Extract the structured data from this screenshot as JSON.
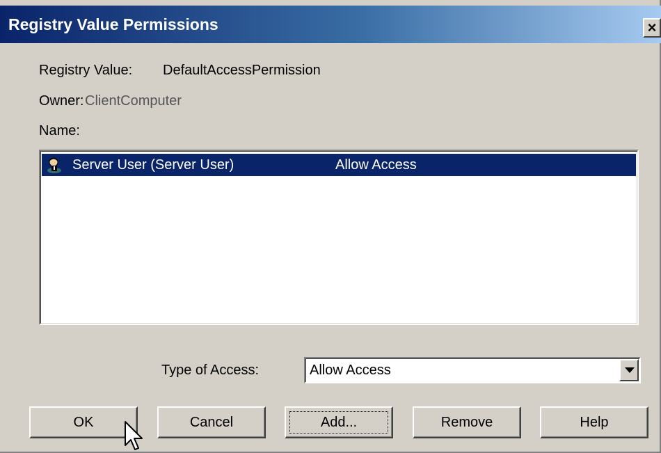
{
  "window": {
    "title": "Registry Value Permissions",
    "close_label": "×"
  },
  "info": {
    "registry_value_label": "Registry Value:",
    "registry_value": "DefaultAccessPermission",
    "owner_label": "Owner:",
    "owner": "ClientComputer",
    "name_label": "Name:"
  },
  "list": {
    "items": [
      {
        "icon": "user-icon",
        "name": "Server User (Server User)",
        "access": "Allow Access",
        "selected": true
      }
    ]
  },
  "access": {
    "label": "Type of Access:",
    "selected": "Allow Access"
  },
  "buttons": {
    "ok": "OK",
    "cancel": "Cancel",
    "add": "Add...",
    "remove": "Remove",
    "help": "Help"
  },
  "colors": {
    "selection": "#0a246a",
    "dialog_bg": "#d4d0c8"
  }
}
